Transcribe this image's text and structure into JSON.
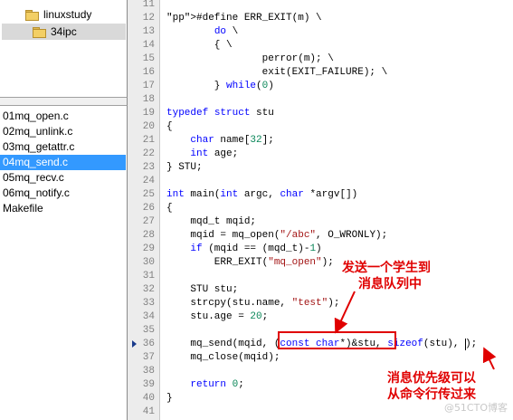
{
  "folder_tree": {
    "items": [
      {
        "label": "linuxstudy",
        "selected": false
      },
      {
        "label": "34ipc",
        "selected": true
      }
    ]
  },
  "file_list": {
    "items": [
      {
        "label": "01mq_open.c",
        "selected": false
      },
      {
        "label": "02mq_unlink.c",
        "selected": false
      },
      {
        "label": "03mq_getattr.c",
        "selected": false
      },
      {
        "label": "04mq_send.c",
        "selected": true
      },
      {
        "label": "05mq_recv.c",
        "selected": false
      },
      {
        "label": "06mq_notify.c",
        "selected": false
      },
      {
        "label": "Makefile",
        "selected": false
      }
    ]
  },
  "editor": {
    "current_line": 36,
    "lines": [
      {
        "num": "11",
        "code": ""
      },
      {
        "num": "12",
        "code": "#define ERR_EXIT(m) \\"
      },
      {
        "num": "13",
        "code": "        do \\"
      },
      {
        "num": "14",
        "code": "        { \\"
      },
      {
        "num": "15",
        "code": "                perror(m); \\"
      },
      {
        "num": "16",
        "code": "                exit(EXIT_FAILURE); \\"
      },
      {
        "num": "17",
        "code": "        } while(0)"
      },
      {
        "num": "18",
        "code": ""
      },
      {
        "num": "19",
        "code": "typedef struct stu"
      },
      {
        "num": "20",
        "code": "{"
      },
      {
        "num": "21",
        "code": "    char name[32];"
      },
      {
        "num": "22",
        "code": "    int age;"
      },
      {
        "num": "23",
        "code": "} STU;"
      },
      {
        "num": "24",
        "code": ""
      },
      {
        "num": "25",
        "code": "int main(int argc, char *argv[])"
      },
      {
        "num": "26",
        "code": "{"
      },
      {
        "num": "27",
        "code": "    mqd_t mqid;"
      },
      {
        "num": "28",
        "code": "    mqid = mq_open(\"/abc\", O_WRONLY);"
      },
      {
        "num": "29",
        "code": "    if (mqid == (mqd_t)-1)"
      },
      {
        "num": "30",
        "code": "        ERR_EXIT(\"mq_open\");"
      },
      {
        "num": "31",
        "code": ""
      },
      {
        "num": "32",
        "code": "    STU stu;"
      },
      {
        "num": "33",
        "code": "    strcpy(stu.name, \"test\");"
      },
      {
        "num": "34",
        "code": "    stu.age = 20;"
      },
      {
        "num": "35",
        "code": ""
      },
      {
        "num": "36",
        "code": "    mq_send(mqid, (const char*)&stu, sizeof(stu), );"
      },
      {
        "num": "37",
        "code": "    mq_close(mqid);"
      },
      {
        "num": "38",
        "code": ""
      },
      {
        "num": "39",
        "code": "    return 0;"
      },
      {
        "num": "40",
        "code": "}"
      },
      {
        "num": "41",
        "code": ""
      }
    ]
  },
  "annotations": {
    "cast_note": [
      "发送一个学生到",
      "消息队列中"
    ],
    "priority_note": [
      "消息优先级可以",
      "从命令行传过来"
    ],
    "highlight_text": "(const char*)&stu,",
    "color": "#e00000"
  },
  "watermark": "@51CTO博客",
  "icons": [
    "folder-icon",
    "current-line-arrow-icon"
  ]
}
